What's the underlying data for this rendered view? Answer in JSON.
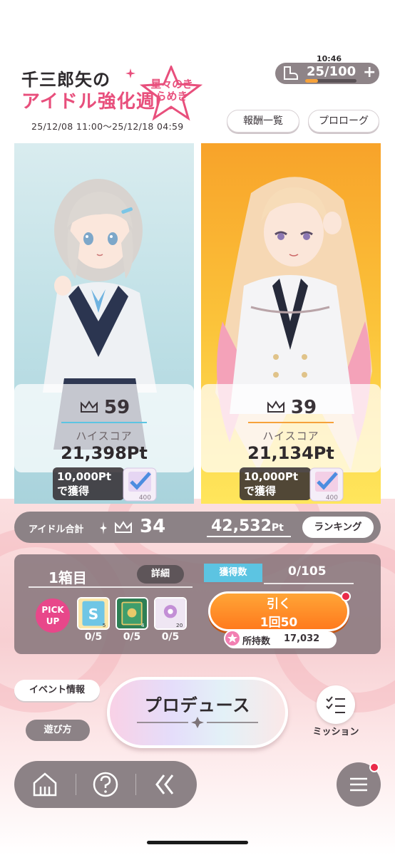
{
  "header": {
    "logo_line1": "千三郎矢の",
    "logo_line2": "アイドル強化週間",
    "logo_subtitle": "星々のきらめき",
    "period": "25/12/08 11:00～25/12/18 04:59",
    "rewards_label": "報酬一覧",
    "prologue_label": "プロローグ"
  },
  "stamina": {
    "time": "10:46",
    "value": "25/100",
    "fill_fraction": 0.25,
    "icon": "boot-icon",
    "plus": "+"
  },
  "idols": [
    {
      "rank": "59",
      "highscore_label": "ハイスコア",
      "highscore": "21,398Pt",
      "reward_line1": "10,000Pt",
      "reward_line2": "で獲得",
      "ticket_count": "400",
      "accent": "#5cc4e2"
    },
    {
      "rank": "39",
      "highscore_label": "ハイスコア",
      "highscore": "21,134Pt",
      "reward_line1": "10,000Pt",
      "reward_line2": "で獲得",
      "ticket_count": "400",
      "accent": "#f6a23a"
    }
  ],
  "total": {
    "label": "アイドル合計",
    "rank": "34",
    "score": "42,532",
    "score_unit": "Pt",
    "ranking_label": "ランキング"
  },
  "box": {
    "title": "1箱目",
    "detail_label": "詳細",
    "obtained_label": "獲得数",
    "obtained_count": "0/105",
    "pickup_line1": "PICK",
    "pickup_line2": "UP",
    "items": [
      {
        "icon": "s-card-icon",
        "count": "0/5",
        "badge": "5"
      },
      {
        "icon": "green-card-icon",
        "count": "0/5",
        "badge": "4"
      },
      {
        "icon": "flower-card-icon",
        "count": "0/5",
        "badge": "20"
      }
    ],
    "pull_label": "引く",
    "pull_cost": "1回50",
    "owned_label": "所持数",
    "owned_value": "17,032"
  },
  "bottom": {
    "event_info_label": "イベント情報",
    "how_to_play_label": "遊び方",
    "produce_label": "プロデュース",
    "mission_label": "ミッション"
  },
  "nav": {
    "items": [
      "home-icon",
      "help-icon",
      "back-icon"
    ]
  },
  "colors": {
    "accent_blue": "#5cc4e2",
    "accent_orange": "#ff8a25",
    "pink": "#e8478a",
    "panel_gray": "#8c8286"
  }
}
